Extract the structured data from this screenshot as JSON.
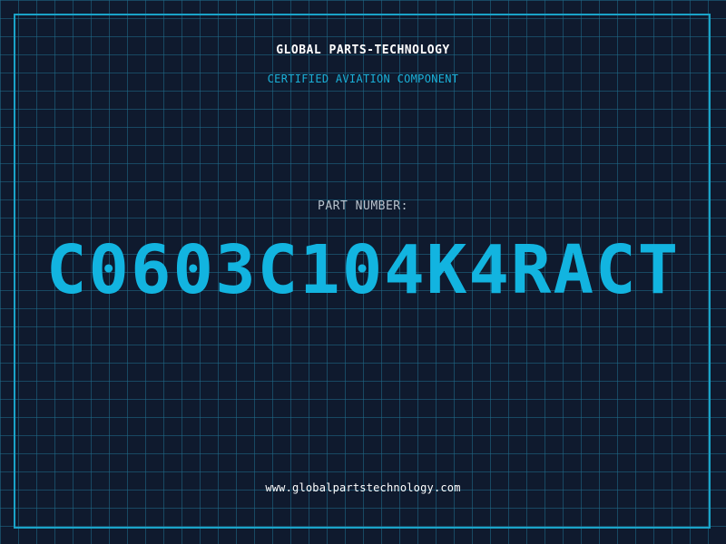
{
  "company_name": "GLOBAL PARTS-TECHNOLOGY",
  "tagline": "CERTIFIED AVIATION COMPONENT",
  "part_label": "PART NUMBER:",
  "part_number": "C0603C104K4RACT",
  "website": "www.globalpartstechnology.com",
  "colors": {
    "background": "#0f1a2e",
    "grid": "#1f6e8c",
    "frame": "#1aa3c8",
    "accent": "#12b4e0",
    "title_text": "#ffffff",
    "label_text": "#b8c2cc"
  }
}
